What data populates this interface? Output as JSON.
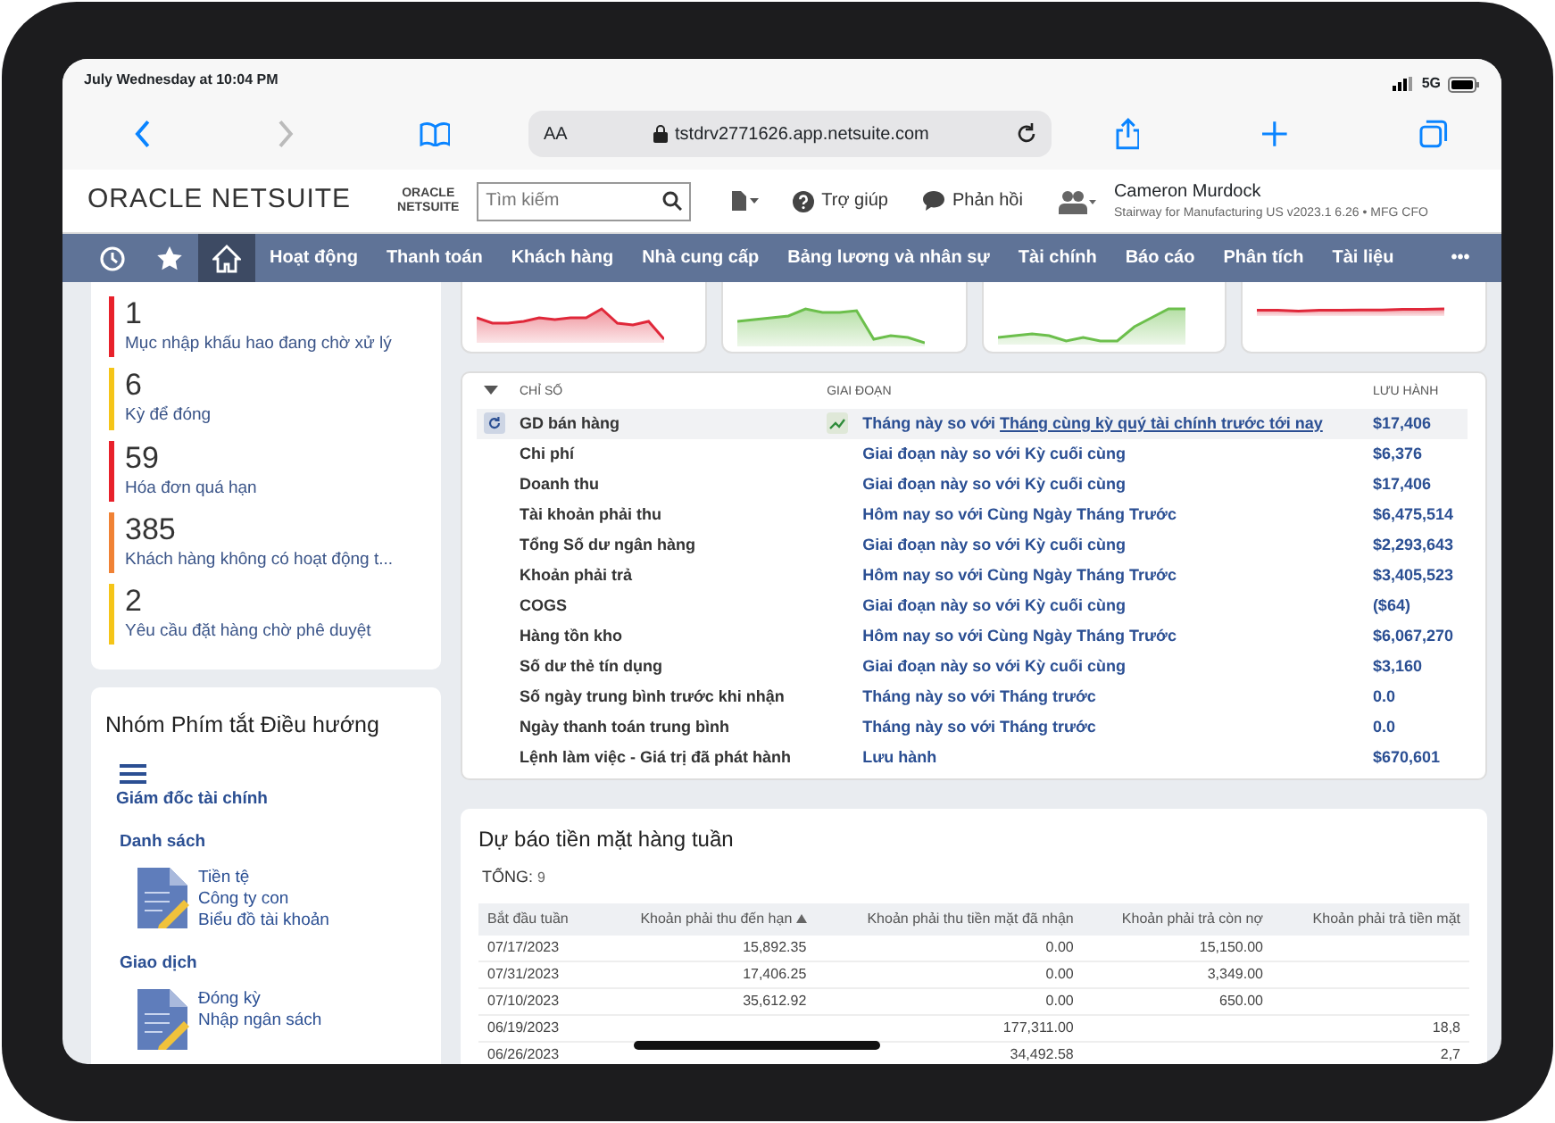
{
  "status_bar": {
    "time": "July Wednesday at 10:04 PM",
    "network": "5G"
  },
  "browser": {
    "text_size": "AA",
    "url": "tstdrv2771626.app.netsuite.com"
  },
  "header": {
    "logo": "ORACLE NETSUITE",
    "small_logo_top": "ORACLE",
    "small_logo_bottom": "NETSUITE",
    "search": {
      "placeholder": "Tìm kiếm"
    },
    "help": "Trợ giúp",
    "feedback": "Phản hồi",
    "user_name": "Cameron Murdock",
    "user_role": "Stairway for Manufacturing US v2023.1 6.26 • MFG CFO"
  },
  "nav": {
    "icon_tabs": [
      {
        "kind": "recent",
        "selected": false
      },
      {
        "kind": "star",
        "selected": false
      },
      {
        "kind": "home",
        "selected": true
      }
    ],
    "tabs": [
      {
        "label": "Hoạt động",
        "selected": false
      },
      {
        "label": "Thanh toán",
        "selected": false
      },
      {
        "label": "Khách hàng",
        "selected": false
      },
      {
        "label": "Nhà cung cấp",
        "selected": false
      },
      {
        "label": "Bảng lương và nhân sự",
        "selected": false
      },
      {
        "label": "Tài chính",
        "selected": false
      },
      {
        "label": "Báo cáo",
        "selected": false
      },
      {
        "label": "Phân tích",
        "selected": false
      },
      {
        "label": "Tài liệu",
        "selected": false
      }
    ],
    "more": "•••"
  },
  "reminders": [
    {
      "count": "1",
      "label": "Mục nhập khấu hao đang chờ xử lý",
      "color": "#e8212b"
    },
    {
      "count": "6",
      "label": "Kỳ để đóng",
      "color": "#f5c518"
    },
    {
      "count": "59",
      "label": "Hóa đơn quá hạn",
      "color": "#e8212b"
    },
    {
      "count": "385",
      "label": "Khách hàng không có hoạt động t...",
      "color": "#f08235"
    },
    {
      "count": "2",
      "label": "Yêu cầu đặt hàng chờ phê duyệt",
      "color": "#f5c518"
    }
  ],
  "shortcuts": {
    "title": "Nhóm Phím tắt Điều hướng",
    "role": "Giám đốc tài chính",
    "groups": [
      {
        "title": "Danh sách",
        "links": [
          "Tiền tệ",
          "Công ty con",
          "Biểu đồ tài khoản"
        ]
      },
      {
        "title": "Giao dịch",
        "links": [
          "Đóng kỳ",
          "Nhập ngân sách"
        ]
      }
    ]
  },
  "kpi_cards": [
    {
      "color": "#e0283a"
    },
    {
      "color": "#6cbf4c"
    },
    {
      "color": "#6cbf4c"
    },
    {
      "color": "#e0283a"
    }
  ],
  "metrics": {
    "columns": [
      "CHỈ SỐ",
      "GIAI ĐOẠN",
      "LƯU HÀNH"
    ],
    "rows": [
      {
        "name": "GD bán hàng",
        "period": "Tháng này so với ",
        "period_link": "Tháng cùng kỳ quý tài chính trước tới nay",
        "value": "$17,406",
        "selected": true
      },
      {
        "name": "Chi phí",
        "period": "Giai đoạn này so với Kỳ cuối cùng",
        "value": "$6,376",
        "selected": false
      },
      {
        "name": "Doanh thu",
        "period": "Giai đoạn này so với Kỳ cuối cùng",
        "value": "$17,406",
        "selected": false
      },
      {
        "name": "Tài khoản phải thu",
        "period": "Hôm nay so với Cùng Ngày Tháng Trước",
        "value": "$6,475,514",
        "selected": false
      },
      {
        "name": "Tổng Số dư ngân hàng",
        "period": "Giai đoạn này so với Kỳ cuối cùng",
        "value": "$2,293,643",
        "selected": false
      },
      {
        "name": "Khoản phải trả",
        "period": "Hôm nay so với Cùng Ngày Tháng Trước",
        "value": "$3,405,523",
        "selected": false
      },
      {
        "name": "COGS",
        "period": "Giai đoạn này so với Kỳ cuối cùng",
        "value": "($64)",
        "selected": false
      },
      {
        "name": "Hàng tồn kho",
        "period": "Hôm nay so với Cùng Ngày Tháng Trước",
        "value": "$6,067,270",
        "selected": false
      },
      {
        "name": "Số dư thẻ tín dụng",
        "period": "Giai đoạn này so với Kỳ cuối cùng",
        "value": "$3,160",
        "selected": false
      },
      {
        "name": "Số ngày trung bình trước khi nhận",
        "period": "Tháng này so với Tháng trước",
        "value": "0.0",
        "selected": false
      },
      {
        "name": "Ngày thanh toán trung bình",
        "period": "Tháng này so với Tháng trước",
        "value": "0.0",
        "selected": false
      },
      {
        "name": "Lệnh làm việc - Giá trị đã phát hành",
        "period": "Lưu hành",
        "value": "$670,601",
        "selected": false
      }
    ]
  },
  "cash_forecast": {
    "title": "Dự báo tiền mặt hàng tuần",
    "total_label": "TỔNG:",
    "total": "9",
    "columns": [
      {
        "label": "Bắt đầu tuần",
        "sorted": false
      },
      {
        "label": "Khoản phải thu đến hạn",
        "sorted": true
      },
      {
        "label": "Khoản phải thu tiền mặt đã nhận",
        "sorted": false
      },
      {
        "label": "Khoản phải trả còn nợ",
        "sorted": false
      },
      {
        "label": "Khoản phải trả tiền mặt",
        "sorted": false
      }
    ],
    "rows": [
      [
        "07/17/2023",
        "15,892.35",
        "0.00",
        "15,150.00",
        ""
      ],
      [
        "07/31/2023",
        "17,406.25",
        "0.00",
        "3,349.00",
        ""
      ],
      [
        "07/10/2023",
        "35,612.92",
        "0.00",
        "650.00",
        ""
      ],
      [
        "06/19/2023",
        "",
        "177,311.00",
        "",
        "18,8"
      ],
      [
        "06/26/2023",
        "",
        "34,492.58",
        "",
        "2,7"
      ]
    ]
  }
}
